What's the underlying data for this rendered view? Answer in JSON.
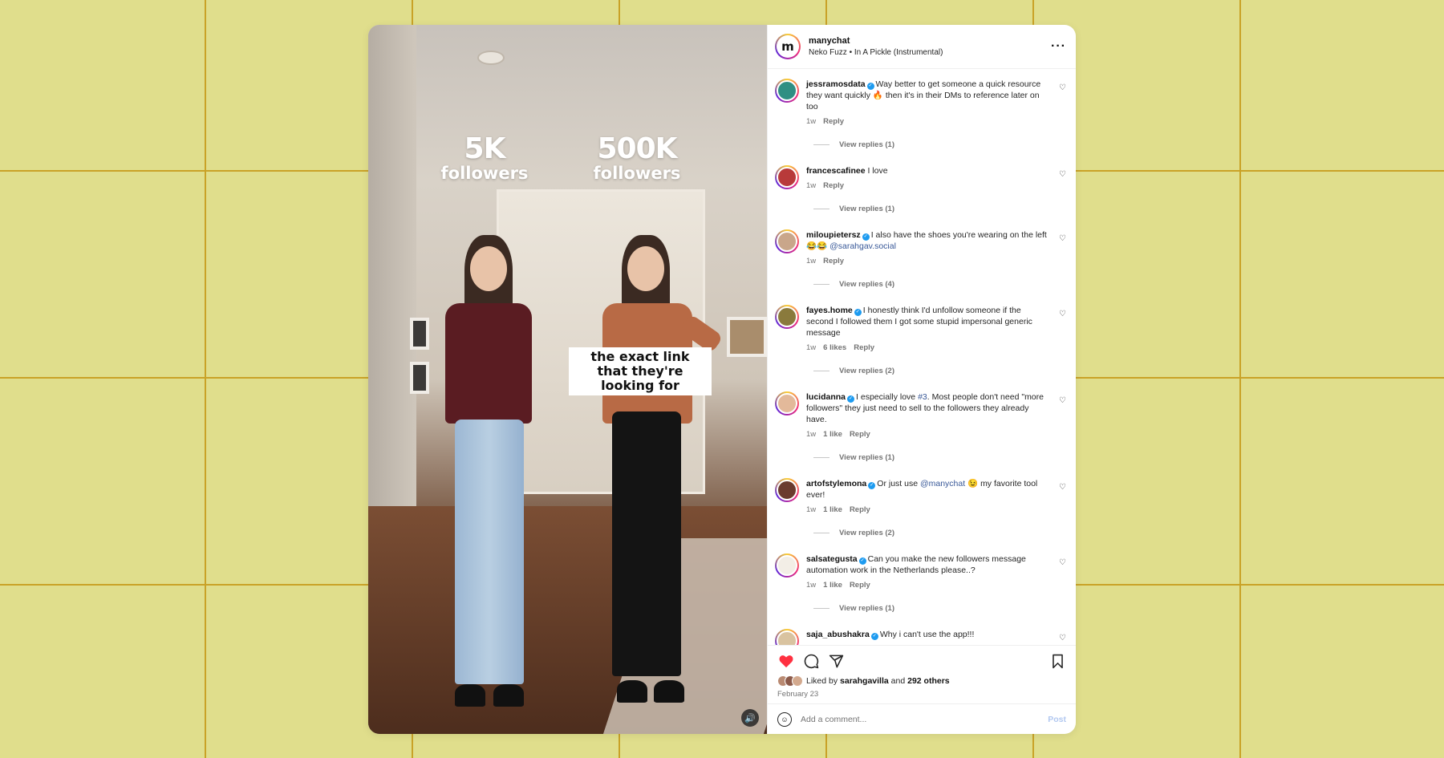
{
  "post": {
    "account": "manychat",
    "logo_letter": "m",
    "audio": "Neko Fuzz • In A Pickle (Instrumental)",
    "more_label": "···"
  },
  "media": {
    "left_num": "5K",
    "left_sub": "followers",
    "right_num": "500K",
    "right_sub": "followers",
    "caption": "the exact link that they're looking for",
    "sound_icon": "speaker-icon"
  },
  "comments": [
    {
      "user": "jessramosdata",
      "verified": true,
      "text": "Way better to get someone a quick resource they want quickly 🔥 then it's in their DMs to reference later on too",
      "time": "1w",
      "likes": "",
      "reply": "Reply",
      "view_replies": "View replies (1)",
      "avatar_color": "#2f8f83"
    },
    {
      "user": "francescafinee",
      "verified": false,
      "text": "I love",
      "time": "1w",
      "likes": "",
      "reply": "Reply",
      "view_replies": "View replies (1)",
      "avatar_color": "#b83a3a"
    },
    {
      "user": "miloupietersz",
      "verified": true,
      "text_before": "I also have the shoes you're wearing on the left 😂😂 ",
      "mention": "@sarahgav.social",
      "text_after": "",
      "time": "1w",
      "likes": "",
      "reply": "Reply",
      "view_replies": "View replies (4)",
      "avatar_color": "#c9a68a"
    },
    {
      "user": "fayes.home",
      "verified": true,
      "text": "I honestly think I'd unfollow someone if the second I followed them I got some stupid impersonal generic message",
      "time": "1w",
      "likes": "6 likes",
      "reply": "Reply",
      "view_replies": "View replies (2)",
      "avatar_color": "#8a7a3c"
    },
    {
      "user": "lucidanna",
      "verified": true,
      "text_before": "I especially love ",
      "mention": "#3",
      "text_after": ". Most people don't need \"more followers\" they just need to sell to the followers they already have.",
      "time": "1w",
      "likes": "1 like",
      "reply": "Reply",
      "view_replies": "View replies (1)",
      "avatar_color": "#e3b99a"
    },
    {
      "user": "artofstylemona",
      "verified": true,
      "text_before": "Or just use ",
      "mention": "@manychat",
      "text_after": " 😉 my favorite tool ever!",
      "time": "1w",
      "likes": "1 like",
      "reply": "Reply",
      "view_replies": "View replies (2)",
      "avatar_color": "#6b3b2e"
    },
    {
      "user": "salsategusta",
      "verified": true,
      "text": "Can you make the new followers message automation work in the Netherlands please..?",
      "time": "1w",
      "likes": "1 like",
      "reply": "Reply",
      "view_replies": "View replies (1)",
      "avatar_color": "#f3eee6"
    },
    {
      "user": "saja_abushakra",
      "verified": true,
      "text": "Why i can't use the app!!!",
      "time": "",
      "likes": "",
      "reply": "",
      "view_replies": "",
      "avatar_color": "#d9c3a0"
    }
  ],
  "actions": {
    "liked_by_prefix": "Liked by",
    "liked_by_user": "sarahgavilla",
    "liked_by_and": "and",
    "liked_by_others": "292 others",
    "date": "February 23",
    "icons": [
      "heart-icon",
      "comment-icon",
      "share-icon",
      "bookmark-icon"
    ],
    "heart_color": "#ff3040"
  },
  "add_comment": {
    "placeholder": "Add a comment...",
    "post_label": "Post"
  }
}
